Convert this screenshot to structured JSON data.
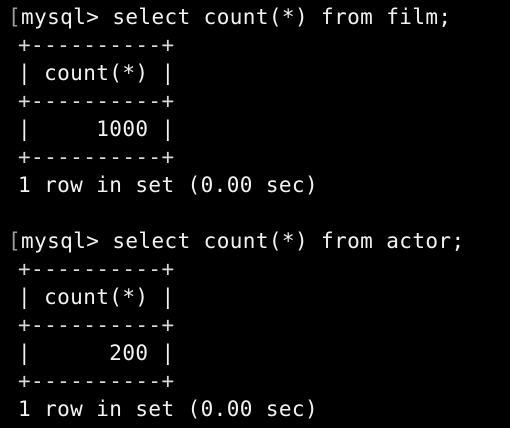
{
  "terminal": {
    "blocks": [
      {
        "bracket": "[",
        "prompt": "mysql> select count(*) from film;",
        "border": "+----------+",
        "header": "| count(*) |",
        "row": "|     1000 |",
        "status": "1 row in set (0.00 sec)"
      },
      {
        "bracket": "[",
        "prompt": "mysql> select count(*) from actor;",
        "border": "+----------+",
        "header": "| count(*) |",
        "row": "|      200 |",
        "status": "1 row in set (0.00 sec)"
      }
    ]
  },
  "colors": {
    "background": "#000000",
    "text": "#f2f2f2"
  }
}
